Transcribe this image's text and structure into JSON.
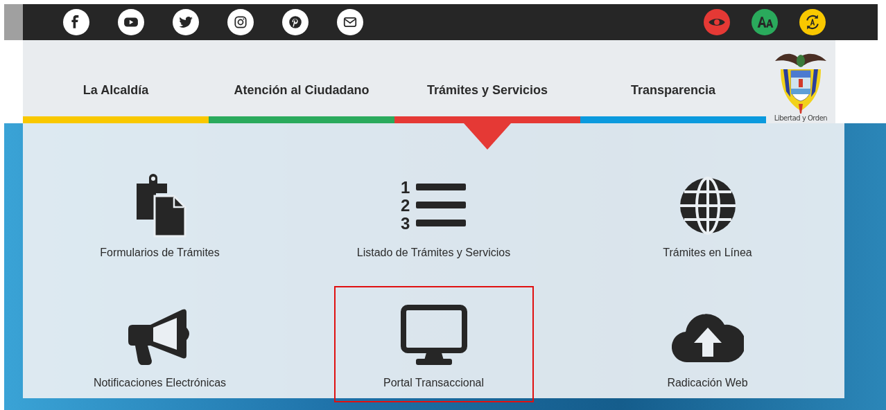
{
  "social_links": [
    {
      "kind": "facebook"
    },
    {
      "kind": "youtube"
    },
    {
      "kind": "twitter"
    },
    {
      "kind": "instagram"
    },
    {
      "kind": "pinterest"
    },
    {
      "kind": "email"
    }
  ],
  "accessibility_tools": [
    {
      "kind": "contrast",
      "color": "#e53935"
    },
    {
      "kind": "text-size",
      "color": "#2aaa5c"
    },
    {
      "kind": "screen-reader",
      "color": "#f9c800"
    }
  ],
  "nav": {
    "items": [
      {
        "label": "La Alcaldía",
        "color": "#f9c800",
        "selected": false
      },
      {
        "label": "Atención al Ciudadano",
        "color": "#2aaa5c",
        "selected": false
      },
      {
        "label": "Trámites y Servicios",
        "color": "#e53935",
        "selected": true
      },
      {
        "label": "Transparencia",
        "color": "#0b9ade",
        "selected": false
      }
    ],
    "emblem_motto": "Libertad y Orden"
  },
  "dropdown": {
    "items": [
      {
        "label": "Formularios de Trámites",
        "kind": "forms",
        "highlighted": false
      },
      {
        "label": "Listado de Trámites y Servicios",
        "kind": "list",
        "highlighted": false,
        "icon_numbers": [
          "1",
          "2",
          "3"
        ]
      },
      {
        "label": "Trámites en Línea",
        "kind": "globe",
        "highlighted": false
      },
      {
        "label": "Notificaciones Electrónicas",
        "kind": "megaphone",
        "highlighted": false
      },
      {
        "label": "Portal Transaccional",
        "kind": "monitor",
        "highlighted": true
      },
      {
        "label": "Radicación Web",
        "kind": "upload",
        "highlighted": false
      }
    ]
  }
}
